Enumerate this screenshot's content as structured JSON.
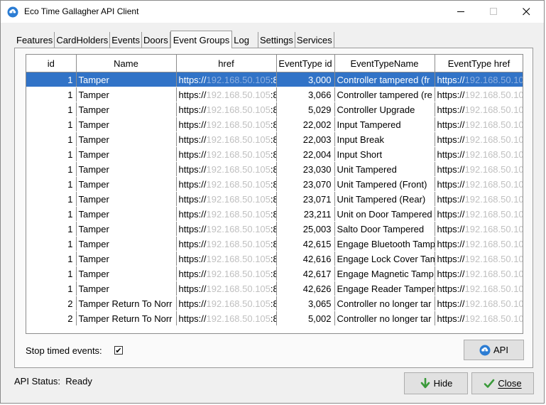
{
  "window": {
    "title": "Eco Time Gallagher API Client"
  },
  "tabs": [
    {
      "label": "Features"
    },
    {
      "label": "CardHolders"
    },
    {
      "label": "Events"
    },
    {
      "label": "Doors"
    },
    {
      "label": "Event Groups",
      "active": true
    },
    {
      "label": "Log"
    },
    {
      "label": "Settings"
    },
    {
      "label": "Services"
    }
  ],
  "grid": {
    "columns": [
      "id",
      "Name",
      "href",
      "EventType id",
      "EventTypeName",
      "EventType href"
    ],
    "rows": [
      {
        "id": "1",
        "name": "Tamper",
        "href_prefix": "https://",
        "href_masked": "192.168.50.105",
        "href_suffix": ":8",
        "event_type_id": "3,000",
        "event_type_name": "Controller tampered (fr",
        "event_type_href_prefix": "https://",
        "event_type_href_masked": "192.168.50.10",
        "selected": true
      },
      {
        "id": "1",
        "name": "Tamper",
        "href_prefix": "https://",
        "href_masked": "192.168.50.105",
        "href_suffix": ":8",
        "event_type_id": "3,066",
        "event_type_name": "Controller tampered (re",
        "event_type_href_prefix": "https://",
        "event_type_href_masked": "192.168.50.10"
      },
      {
        "id": "1",
        "name": "Tamper",
        "href_prefix": "https://",
        "href_masked": "192.168.50.105",
        "href_suffix": ":8",
        "event_type_id": "5,029",
        "event_type_name": "Controller Upgrade",
        "event_type_href_prefix": "https://",
        "event_type_href_masked": "192.168.50.10"
      },
      {
        "id": "1",
        "name": "Tamper",
        "href_prefix": "https://",
        "href_masked": "192.168.50.105",
        "href_suffix": ":8",
        "event_type_id": "22,002",
        "event_type_name": "Input Tampered",
        "event_type_href_prefix": "https://",
        "event_type_href_masked": "192.168.50.10"
      },
      {
        "id": "1",
        "name": "Tamper",
        "href_prefix": "https://",
        "href_masked": "192.168.50.105",
        "href_suffix": ":8",
        "event_type_id": "22,003",
        "event_type_name": "Input Break",
        "event_type_href_prefix": "https://",
        "event_type_href_masked": "192.168.50.10"
      },
      {
        "id": "1",
        "name": "Tamper",
        "href_prefix": "https://",
        "href_masked": "192.168.50.105",
        "href_suffix": ":8",
        "event_type_id": "22,004",
        "event_type_name": "Input Short",
        "event_type_href_prefix": "https://",
        "event_type_href_masked": "192.168.50.10"
      },
      {
        "id": "1",
        "name": "Tamper",
        "href_prefix": "https://",
        "href_masked": "192.168.50.105",
        "href_suffix": ":8",
        "event_type_id": "23,030",
        "event_type_name": "Unit Tampered",
        "event_type_href_prefix": "https://",
        "event_type_href_masked": "192.168.50.10"
      },
      {
        "id": "1",
        "name": "Tamper",
        "href_prefix": "https://",
        "href_masked": "192.168.50.105",
        "href_suffix": ":8",
        "event_type_id": "23,070",
        "event_type_name": "Unit Tampered (Front)",
        "event_type_href_prefix": "https://",
        "event_type_href_masked": "192.168.50.10"
      },
      {
        "id": "1",
        "name": "Tamper",
        "href_prefix": "https://",
        "href_masked": "192.168.50.105",
        "href_suffix": ":8",
        "event_type_id": "23,071",
        "event_type_name": "Unit Tampered (Rear)",
        "event_type_href_prefix": "https://",
        "event_type_href_masked": "192.168.50.10"
      },
      {
        "id": "1",
        "name": "Tamper",
        "href_prefix": "https://",
        "href_masked": "192.168.50.105",
        "href_suffix": ":8",
        "event_type_id": "23,211",
        "event_type_name": "Unit on Door Tampered",
        "event_type_href_prefix": "https://",
        "event_type_href_masked": "192.168.50.10"
      },
      {
        "id": "1",
        "name": "Tamper",
        "href_prefix": "https://",
        "href_masked": "192.168.50.105",
        "href_suffix": ":8",
        "event_type_id": "25,003",
        "event_type_name": "Salto Door Tampered",
        "event_type_href_prefix": "https://",
        "event_type_href_masked": "192.168.50.10"
      },
      {
        "id": "1",
        "name": "Tamper",
        "href_prefix": "https://",
        "href_masked": "192.168.50.105",
        "href_suffix": ":8",
        "event_type_id": "42,615",
        "event_type_name": "Engage Bluetooth Tamp",
        "event_type_href_prefix": "https://",
        "event_type_href_masked": "192.168.50.10"
      },
      {
        "id": "1",
        "name": "Tamper",
        "href_prefix": "https://",
        "href_masked": "192.168.50.105",
        "href_suffix": ":8",
        "event_type_id": "42,616",
        "event_type_name": "Engage Lock Cover Tam",
        "event_type_href_prefix": "https://",
        "event_type_href_masked": "192.168.50.10"
      },
      {
        "id": "1",
        "name": "Tamper",
        "href_prefix": "https://",
        "href_masked": "192.168.50.105",
        "href_suffix": ":8",
        "event_type_id": "42,617",
        "event_type_name": "Engage Magnetic Tamp",
        "event_type_href_prefix": "https://",
        "event_type_href_masked": "192.168.50.10"
      },
      {
        "id": "1",
        "name": "Tamper",
        "href_prefix": "https://",
        "href_masked": "192.168.50.105",
        "href_suffix": ":8",
        "event_type_id": "42,626",
        "event_type_name": "Engage Reader Tamper",
        "event_type_href_prefix": "https://",
        "event_type_href_masked": "192.168.50.10"
      },
      {
        "id": "2",
        "name": "Tamper Return To Norr",
        "href_prefix": "https://",
        "href_masked": "192.168.50.105",
        "href_suffix": ":8",
        "event_type_id": "3,065",
        "event_type_name": "Controller no longer tar",
        "event_type_href_prefix": "https://",
        "event_type_href_masked": "192.168.50.10"
      },
      {
        "id": "2",
        "name": "Tamper Return To Norr",
        "href_prefix": "https://",
        "href_masked": "192.168.50.105",
        "href_suffix": ":8",
        "event_type_id": "5,002",
        "event_type_name": "Controller no longer tar",
        "event_type_href_prefix": "https://",
        "event_type_href_masked": "192.168.50.10"
      }
    ]
  },
  "options": {
    "stop_timed_events_label": "Stop timed events:",
    "stop_timed_events_checked": "✔"
  },
  "buttons": {
    "api": "API",
    "hide": "Hide",
    "close": "Close"
  },
  "status": {
    "label": "API Status:",
    "value": "Ready"
  }
}
